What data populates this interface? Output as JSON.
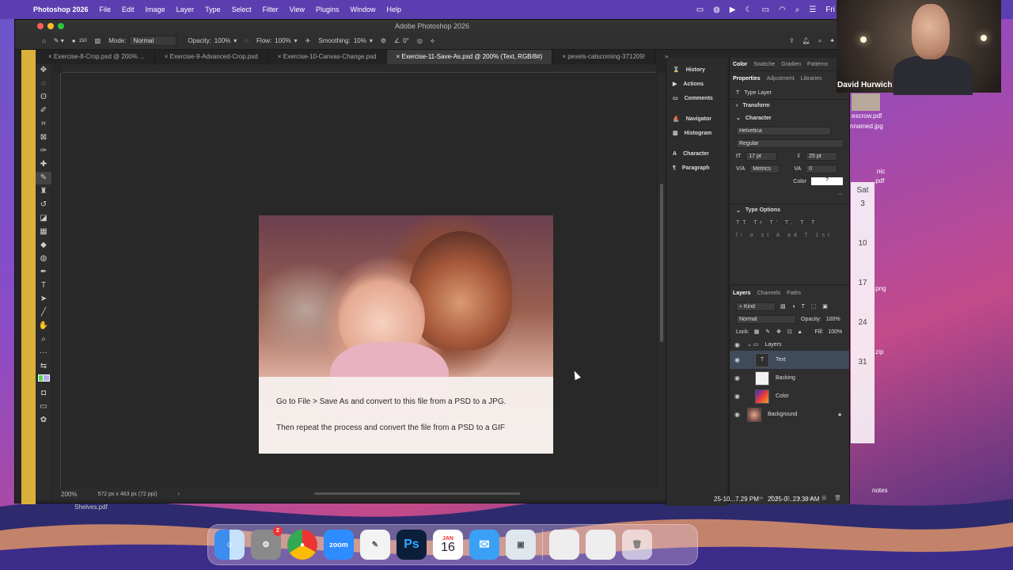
{
  "menubar": {
    "app": "Photoshop 2026",
    "items": [
      "File",
      "Edit",
      "Image",
      "Layer",
      "Type",
      "Select",
      "Filter",
      "View",
      "Plugins",
      "Window",
      "Help"
    ],
    "clock_partial": "Fri"
  },
  "window": {
    "title": "Adobe Photoshop 2026"
  },
  "options": {
    "brush_size": "150",
    "mode_label": "Mode:",
    "mode_value": "Normal",
    "opacity_label": "Opacity:",
    "opacity_value": "100%",
    "flow_label": "Flow:",
    "flow_value": "100%",
    "smoothing_label": "Smoothing:",
    "smoothing_value": "10%",
    "angle_value": "0°"
  },
  "tabs": [
    {
      "label": "Exercise-8-Crop.psd @ 200% ..."
    },
    {
      "label": "Exercise-9-Advanced-Crop.psd"
    },
    {
      "label": "Exercise-10-Canvas-Change.psd"
    },
    {
      "label": "Exercise-11-Save-As.psd @ 200% (Text, RGB/8#)"
    },
    {
      "label": "pexels-catscoming-371209!"
    }
  ],
  "document": {
    "line1": "Go to File > Save As and convert to this file from a  PSD to a JPG.",
    "line2": "Then repeat the process and convert the file from a PSD  to a GIF"
  },
  "status": {
    "zoom": "200%",
    "info": "572 px x 463 px (72 ppi)"
  },
  "dock_panels": [
    "History",
    "Actions",
    "Comments",
    "Navigator",
    "Histogram",
    "Character",
    "Paragraph"
  ],
  "properties": {
    "top_tabs": [
      "Color",
      "Swatche",
      "Gradien",
      "Patterns"
    ],
    "tabs": [
      "Properties",
      "Adjustment",
      "Libraries"
    ],
    "layer_kind": "Type Layer",
    "transform": "Transform",
    "character": "Character",
    "font": "Helvetica",
    "style": "Regular",
    "size": "17 pt",
    "leading": "25 pt",
    "kerning": "Metrics",
    "tracking": "0",
    "color_label": "Color",
    "type_options": "Type Options"
  },
  "layers": {
    "tabs": [
      "Layers",
      "Channels",
      "Paths"
    ],
    "filter": "Kind",
    "blend": "Normal",
    "opacity_label": "Opacity:",
    "opacity": "100%",
    "lock_label": "Lock:",
    "fill_label": "Fill:",
    "fill": "100%",
    "group": "Layers",
    "items": [
      {
        "name": "Text"
      },
      {
        "name": "Backing"
      },
      {
        "name": "Color"
      },
      {
        "name": "Background"
      }
    ]
  },
  "webcam": {
    "name": "David Hurwich"
  },
  "desktop": {
    "files": [
      "escrow.pdf",
      "nnamed.jpg",
      "nic",
      ".pdf",
      ".png",
      ".zip",
      "notes"
    ],
    "dates": [
      "25-10...7.29 PM",
      "2025-0...23.38 AM"
    ],
    "shelves": "Shelves.pdf",
    "cal_day": "Sat",
    "cal_dates": [
      "3",
      "10",
      "17",
      "24",
      "31"
    ]
  },
  "dock": {
    "apps": [
      "Finder",
      "System Settings",
      "Chrome",
      "Zoom",
      "Pages",
      "Ps",
      "Calendar",
      "Mail",
      "Preview"
    ],
    "calendar_month": "JAN",
    "calendar_day": "16",
    "settings_badge": "2"
  },
  "colors": {
    "ps_bg": "#262626",
    "accent": "#4a8fe3",
    "wallpaper": "#7b4fc4"
  }
}
